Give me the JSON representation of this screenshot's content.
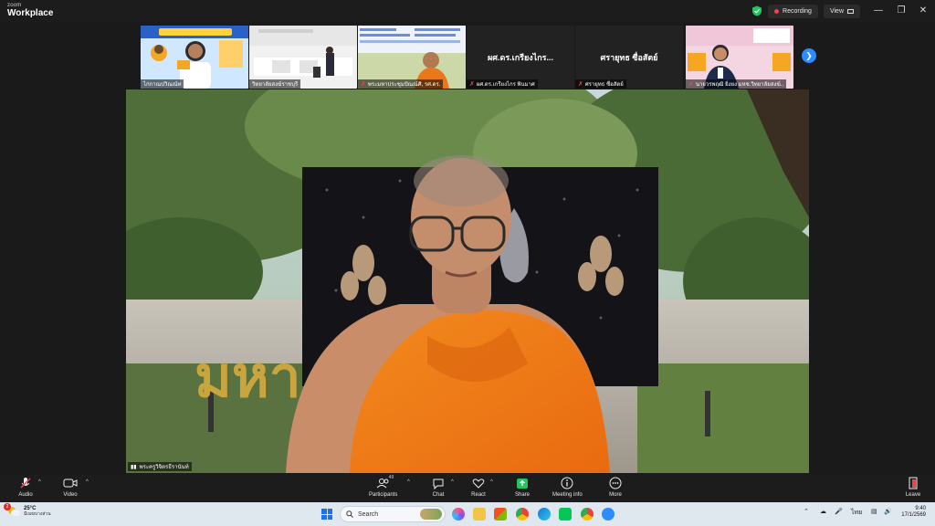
{
  "app": {
    "brand_small": "zoom",
    "brand_big": "Workplace"
  },
  "titlebar": {
    "recording_label": "Recording",
    "view_label": "View"
  },
  "thumbnails": [
    {
      "name": "ไก่กาณปวิณณ์ท",
      "muted": false
    },
    {
      "name": "วิทยาลัยสงฆ์ราชบุรี",
      "muted": false
    },
    {
      "name": "พระมหาประชุมปัณณ์ศิ, รศ.ดร.",
      "muted": true
    },
    {
      "name": "ผศ.ดร.เกรียงไกร พินมาศ",
      "muted": true,
      "title": "ผศ.ดร.เกรียงไกร..."
    },
    {
      "name": "ศรายุทธ ซื่อสัตย์",
      "muted": true,
      "title": "ศรายุทธ ซื่อสัตย์"
    },
    {
      "name": "นายวรพฤฒิ ยิ่งยง มหช.วิทยาลัยสงฆ์..",
      "muted": true
    }
  ],
  "main_video": {
    "speaker_name": "พระครูวิจิตรธีรานันท์",
    "sign_text": "มหา   ศรม"
  },
  "toolbar": {
    "audio": "Audio",
    "video": "Video",
    "participants": "Participants",
    "participants_count": "49",
    "chat": "Chat",
    "react": "React",
    "share": "Share",
    "meeting_info": "Meeting info",
    "more": "More",
    "leave": "Leave"
  },
  "taskbar": {
    "weather_temp": "25°C",
    "weather_desc": "มีเมฆบางส่วน",
    "search_placeholder": "Search",
    "lang": "ไทย",
    "time": "9:40",
    "date": "17/1/2569",
    "notification_count": "2"
  },
  "colors": {
    "zoom_blue": "#2d8cff",
    "recording_red": "#e5484d",
    "share_green": "#23c55e",
    "robe_orange": "#f27a16"
  }
}
